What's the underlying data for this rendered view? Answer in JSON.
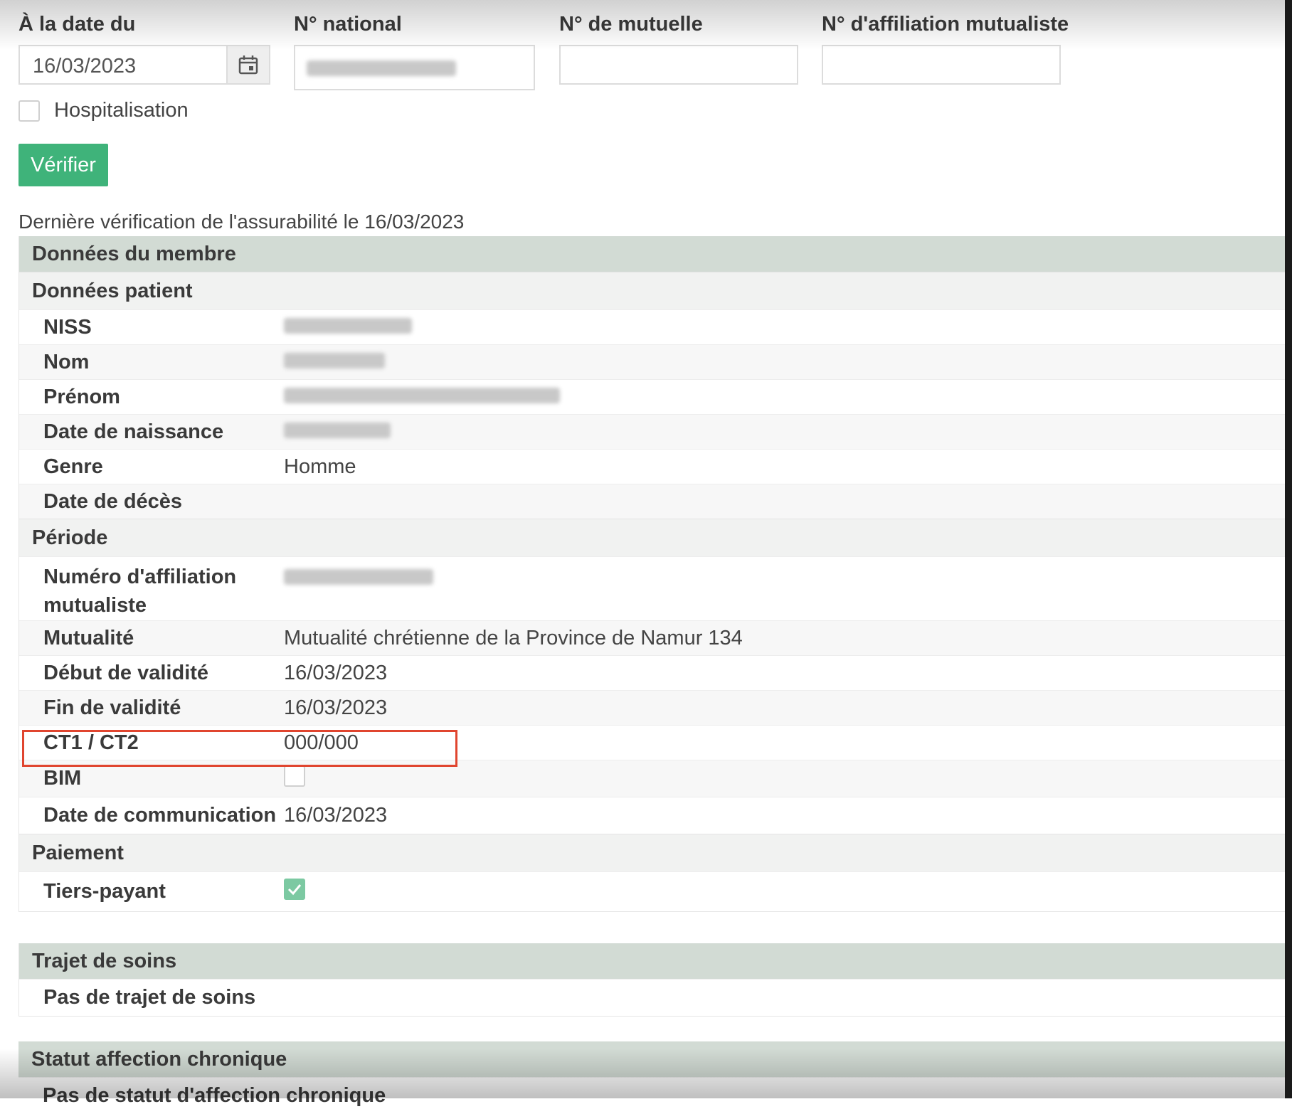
{
  "form": {
    "date_label": "À la date du",
    "date_value": "16/03/2023",
    "national_label": "N° national",
    "mutuelle_label": "N° de mutuelle",
    "affiliation_label": "N° d'affiliation mutualiste",
    "hospitalisation_label": "Hospitalisation",
    "verify_button": "Vérifier"
  },
  "last_check": "Dernière vérification de l'assurabilité le 16/03/2023",
  "member": {
    "header": "Données du membre",
    "patient_header": "Données patient",
    "patient_rows": [
      {
        "label": "NISS",
        "value": ""
      },
      {
        "label": "Nom",
        "value": ""
      },
      {
        "label": "Prénom",
        "value": ""
      },
      {
        "label": "Date de naissance",
        "value": ""
      },
      {
        "label": "Genre",
        "value": "Homme"
      },
      {
        "label": "Date de décès",
        "value": ""
      }
    ],
    "period_header": "Période",
    "period_rows": [
      {
        "label": "Numéro d'affiliation mutualiste",
        "value": ""
      },
      {
        "label": "Mutualité",
        "value": "Mutualité chrétienne de la Province de Namur 134"
      },
      {
        "label": "Début de validité",
        "value": "16/03/2023"
      },
      {
        "label": "Fin de validité",
        "value": "16/03/2023"
      },
      {
        "label": "CT1 / CT2",
        "value": "000/000"
      },
      {
        "label": "BIM",
        "value": ""
      },
      {
        "label": "Date de communication",
        "value": "16/03/2023"
      }
    ],
    "payment_header": "Paiement",
    "payment_rows": [
      {
        "label": "Tiers-payant",
        "value": ""
      }
    ]
  },
  "care_path": {
    "header": "Trajet de soins",
    "text": "Pas de trajet de soins"
  },
  "chronic": {
    "header": "Statut affection chronique",
    "text": "Pas de statut d'affection chronique"
  },
  "colors": {
    "accent": "#3fb37a",
    "header_bg": "#d2dbd4",
    "highlight": "#e0452f"
  }
}
